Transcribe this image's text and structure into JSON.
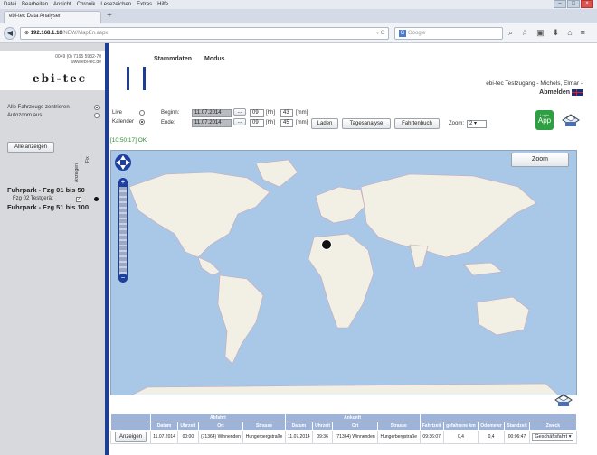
{
  "browser": {
    "menu": [
      "Datei",
      "Bearbeiten",
      "Ansicht",
      "Chronik",
      "Lesezeichen",
      "Extras",
      "Hilfe"
    ],
    "tab_title": "ebi-tec Data Analyser",
    "new_tab": "+",
    "url_host": "192.168.1.10",
    "url_path": "/NEW/MapEn.aspx",
    "search_placeholder": "Google",
    "search_engine": "G"
  },
  "sidebar": {
    "phone": "0049 (0) 7195 5932-70",
    "web": "www.ebi-tec.de",
    "logo": "ebi-tec",
    "center_all": "Alle Fahrzeuge zentrieren",
    "autozoom": "Autozoom aus",
    "show_all": "Alle anzeigen",
    "col_show": "Anzeigen",
    "col_fix": "Fix",
    "fleet_1": "Fuhrpark - Fzg 01 bis 50",
    "vehicle": "Fzg 02 Testgerät",
    "vehicle_check": "✓",
    "fleet_2": "Fuhrpark - Fzg 51 bis 100"
  },
  "topnav": {
    "items": [
      "Stammdaten",
      "Modus"
    ]
  },
  "user": {
    "account": "ebi-tec Testzugang - Michels, Elmar -",
    "logout": "Abmelden"
  },
  "form": {
    "live": "Live",
    "calendar": "Kalender",
    "begin_label": "Beginn:",
    "begin_date": "11.07.2014",
    "begin_hh": "09",
    "begin_mm": "43",
    "end_label": "Ende:",
    "end_date": "11.07.2014",
    "end_hh": "09",
    "end_mm": "45",
    "hh_unit": "[hh]",
    "mm_unit": "[mm]",
    "dots": "...",
    "load": "Laden",
    "day_analysis": "Tagesanalyse",
    "logbook": "Fahrtenbuch",
    "zoom_label": "Zoom:",
    "zoom_value": "2"
  },
  "status": "[10:50:17] OK",
  "app": {
    "label": "App",
    "sub": "Login"
  },
  "map": {
    "zoom_button": "Zoom"
  },
  "table": {
    "group_departure": "Abfahrt",
    "group_arrival": "Ankunft",
    "headers": [
      "Datum",
      "Uhrzeit",
      "Ort",
      "Strasse",
      "Datum",
      "Uhrzeit",
      "Ort",
      "Strasse",
      "Fahrtzeit",
      "gefahrene km",
      "Odometer",
      "Standzeit",
      "Zweck"
    ],
    "row": {
      "button": "Anzeigen",
      "dep_date": "11.07.2014",
      "dep_time": "00:00",
      "dep_place": "(71364) Winnenden",
      "dep_street": "Hungerbergstraße",
      "arr_date": "11.07.2014",
      "arr_time": "09:36",
      "arr_place": "(71364) Winnenden",
      "arr_street": "Hungerbergstraße",
      "duration": "09:36:07",
      "km": "0,4",
      "odometer": "0,4",
      "idle": "00:06:47",
      "purpose": "Geschäftsfahrt"
    }
  },
  "colors": {
    "brand_blue": "#1c3f95",
    "ok_green": "#2e8b2e",
    "table_head": "#9db3d9"
  }
}
